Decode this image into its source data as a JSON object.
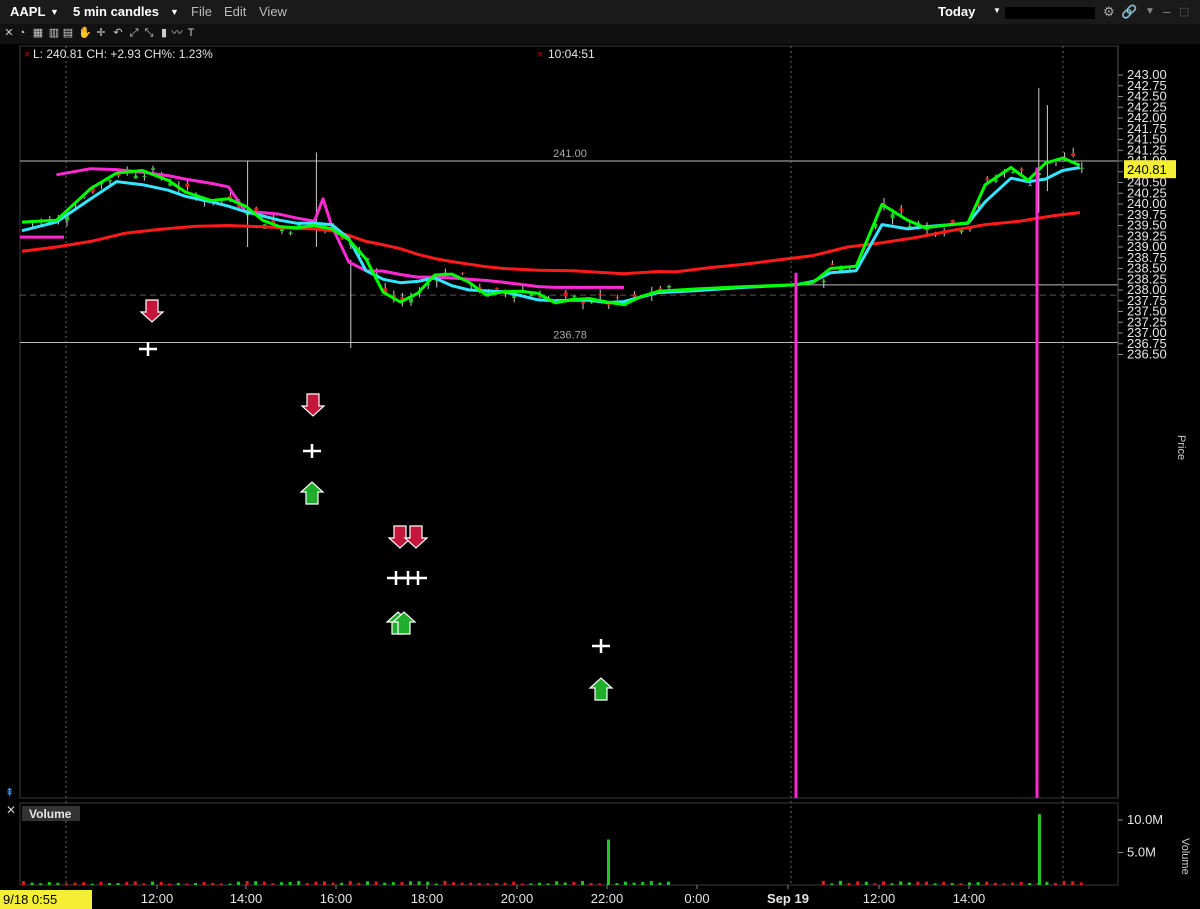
{
  "header": {
    "symbol": "AAPL",
    "interval": "5 min candles",
    "menu_file": "File",
    "menu_edit": "Edit",
    "menu_view": "View",
    "range": "Today"
  },
  "info": {
    "quote": "L: 240.81 CH: +2.93 CH%: 1.23%",
    "time": "10:04:51"
  },
  "volume_panel": {
    "title": "Volume",
    "ticks": [
      "10.0M",
      "5.0M"
    ]
  },
  "chart_data": {
    "type": "candlestick",
    "symbol": "AAPL",
    "ylabel": "Price",
    "ylim": [
      236.25,
      243.25
    ],
    "y_ticks": [
      "243.00",
      "242.75",
      "242.50",
      "242.25",
      "242.00",
      "241.75",
      "241.50",
      "241.25",
      "241.00",
      "240.75",
      "240.50",
      "240.25",
      "240.00",
      "239.75",
      "239.50",
      "239.25",
      "239.00",
      "238.75",
      "238.50",
      "238.25",
      "238.00",
      "237.75",
      "237.50",
      "237.25",
      "237.00",
      "236.75",
      "236.50"
    ],
    "x_ticks": [
      "12:00",
      "14:00",
      "16:00",
      "18:00",
      "20:00",
      "22:00",
      "0:00",
      "Sep 19",
      "12:00",
      "14:00"
    ],
    "x_start_label": "9/18 0:55",
    "last_price": 240.81,
    "levels": [
      {
        "value": 241.0,
        "label": "241.00"
      },
      {
        "value": 236.78,
        "label": "236.78"
      },
      {
        "value": 238.12,
        "label": ""
      }
    ],
    "series": [
      {
        "name": "",
        "color": "#00ff00",
        "points": [
          [
            0,
            239.58
          ],
          [
            4,
            239.62
          ],
          [
            8,
            240.36
          ],
          [
            11,
            240.72
          ],
          [
            14,
            240.78
          ],
          [
            17,
            240.55
          ],
          [
            19,
            240.28
          ],
          [
            22,
            240.08
          ],
          [
            24,
            240.12
          ],
          [
            26,
            239.95
          ],
          [
            28,
            239.62
          ],
          [
            30,
            239.47
          ],
          [
            32,
            239.45
          ],
          [
            34,
            239.5
          ],
          [
            36,
            239.42
          ],
          [
            38,
            239.17
          ],
          [
            40,
            238.72
          ],
          [
            42,
            237.95
          ],
          [
            44,
            237.72
          ],
          [
            46,
            237.92
          ],
          [
            48,
            238.35
          ],
          [
            50,
            238.37
          ],
          [
            52,
            238.18
          ],
          [
            54,
            237.88
          ],
          [
            56,
            237.96
          ],
          [
            58,
            237.97
          ],
          [
            60,
            237.92
          ],
          [
            62,
            237.7
          ],
          [
            64,
            237.78
          ],
          [
            66,
            237.8
          ],
          [
            68,
            237.72
          ],
          [
            70,
            237.66
          ],
          [
            72,
            237.85
          ],
          [
            74,
            237.97
          ],
          [
            78,
            238.02
          ],
          [
            84,
            238.08
          ],
          [
            90,
            238.12
          ],
          [
            92,
            238.18
          ],
          [
            94,
            238.5
          ],
          [
            97,
            238.55
          ],
          [
            100,
            239.99
          ],
          [
            103,
            239.62
          ],
          [
            105,
            239.45
          ],
          [
            108,
            239.52
          ],
          [
            110,
            239.56
          ],
          [
            112,
            240.45
          ],
          [
            115,
            240.85
          ],
          [
            117,
            240.55
          ],
          [
            119,
            240.95
          ],
          [
            121,
            241.07
          ],
          [
            123,
            240.9
          ]
        ]
      },
      {
        "name": "",
        "color": "#33e5ff",
        "points": [
          [
            0,
            239.38
          ],
          [
            4,
            239.58
          ],
          [
            8,
            240.12
          ],
          [
            11,
            240.52
          ],
          [
            14,
            240.45
          ],
          [
            17,
            240.32
          ],
          [
            19,
            240.18
          ],
          [
            22,
            240.05
          ],
          [
            24,
            239.95
          ],
          [
            26,
            239.82
          ],
          [
            28,
            239.72
          ],
          [
            30,
            239.62
          ],
          [
            32,
            239.55
          ],
          [
            34,
            239.55
          ],
          [
            36,
            239.52
          ],
          [
            38,
            239.2
          ],
          [
            40,
            238.45
          ],
          [
            42,
            238.25
          ],
          [
            44,
            238.17
          ],
          [
            46,
            238.2
          ],
          [
            48,
            238.28
          ],
          [
            50,
            238.1
          ],
          [
            52,
            238.0
          ],
          [
            54,
            237.98
          ],
          [
            56,
            237.96
          ],
          [
            58,
            237.87
          ],
          [
            60,
            237.77
          ],
          [
            62,
            237.75
          ],
          [
            64,
            237.76
          ],
          [
            66,
            237.76
          ],
          [
            68,
            237.71
          ],
          [
            70,
            237.73
          ],
          [
            72,
            237.84
          ],
          [
            74,
            237.94
          ],
          [
            78,
            237.98
          ],
          [
            84,
            238.06
          ],
          [
            90,
            238.12
          ],
          [
            92,
            238.2
          ],
          [
            94,
            238.4
          ],
          [
            97,
            238.45
          ],
          [
            100,
            239.52
          ],
          [
            103,
            239.42
          ],
          [
            105,
            239.47
          ],
          [
            108,
            239.52
          ],
          [
            110,
            239.55
          ],
          [
            112,
            240.05
          ],
          [
            115,
            240.6
          ],
          [
            117,
            240.52
          ],
          [
            119,
            240.58
          ],
          [
            121,
            240.78
          ],
          [
            123,
            240.85
          ]
        ]
      },
      {
        "name": "",
        "color": "#ff29d4",
        "points": [
          [
            4,
            240.68
          ],
          [
            8,
            240.82
          ],
          [
            11,
            240.8
          ],
          [
            14,
            240.74
          ],
          [
            17,
            240.66
          ],
          [
            19,
            240.58
          ],
          [
            22,
            240.48
          ],
          [
            24,
            240.4
          ],
          [
            26,
            239.82
          ],
          [
            28,
            239.8
          ],
          [
            30,
            239.76
          ],
          [
            32,
            239.67
          ],
          [
            34,
            239.6
          ],
          [
            35,
            240.12
          ],
          [
            36,
            239.5
          ],
          [
            38,
            238.65
          ],
          [
            40,
            238.45
          ],
          [
            42,
            238.44
          ],
          [
            44,
            238.36
          ],
          [
            46,
            238.3
          ],
          [
            48,
            238.3
          ],
          [
            50,
            238.28
          ],
          [
            52,
            238.25
          ],
          [
            54,
            238.22
          ],
          [
            56,
            238.18
          ],
          [
            58,
            238.13
          ],
          [
            60,
            238.08
          ],
          [
            62,
            238.06
          ],
          [
            66,
            238.06
          ],
          [
            70,
            238.06
          ]
        ]
      },
      {
        "name": "",
        "color": "#ff1a1a",
        "points": [
          [
            0,
            238.9
          ],
          [
            4,
            239.0
          ],
          [
            8,
            239.13
          ],
          [
            12,
            239.32
          ],
          [
            16,
            239.41
          ],
          [
            20,
            239.48
          ],
          [
            24,
            239.5
          ],
          [
            28,
            239.47
          ],
          [
            32,
            239.43
          ],
          [
            34,
            239.42
          ],
          [
            36,
            239.38
          ],
          [
            38,
            239.27
          ],
          [
            40,
            239.13
          ],
          [
            42,
            239.05
          ],
          [
            44,
            238.96
          ],
          [
            46,
            238.83
          ],
          [
            48,
            238.73
          ],
          [
            50,
            238.66
          ],
          [
            52,
            238.6
          ],
          [
            54,
            238.54
          ],
          [
            56,
            238.5
          ],
          [
            58,
            238.48
          ],
          [
            60,
            238.46
          ],
          [
            64,
            238.45
          ],
          [
            70,
            238.38
          ],
          [
            74,
            238.43
          ],
          [
            76,
            238.42
          ],
          [
            80,
            238.52
          ],
          [
            84,
            238.6
          ],
          [
            88,
            238.7
          ],
          [
            92,
            238.8
          ],
          [
            96,
            239.0
          ],
          [
            100,
            239.1
          ],
          [
            104,
            239.22
          ],
          [
            108,
            239.38
          ],
          [
            112,
            239.52
          ],
          [
            116,
            239.6
          ],
          [
            120,
            239.73
          ],
          [
            123,
            239.8
          ]
        ]
      }
    ],
    "volume": {
      "ylim": [
        0,
        12000000
      ],
      "spikes": [
        {
          "label": "22:00",
          "value": 7000000
        },
        {
          "label": "15:30",
          "value": 10900000
        }
      ]
    }
  }
}
